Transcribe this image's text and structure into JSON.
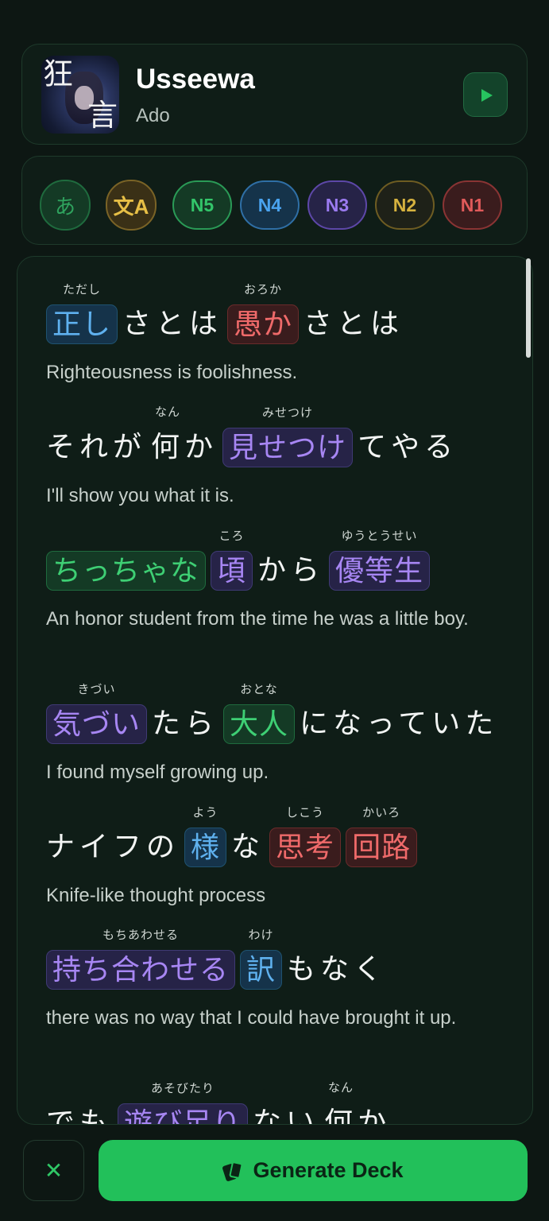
{
  "song": {
    "title": "Usseewa",
    "artist": "Ado",
    "cover_text_top": "狂",
    "cover_text_bottom": "言",
    "play_icon": "play-icon"
  },
  "filters": {
    "hiragana": "あ",
    "grammar": "文A",
    "levels": [
      "N5",
      "N4",
      "N3",
      "N2",
      "N1"
    ],
    "colors": {
      "hiragana": "#2fa35e",
      "grammar": "#e0b53d",
      "N5": "#33c56a",
      "N4": "#4aa3ef",
      "N3": "#9b7bf0",
      "N2": "#d6b23f",
      "N1": "#e05a5a"
    }
  },
  "lyrics": [
    {
      "segments": [
        {
          "text": "正し",
          "ruby": "ただし",
          "level": "blue"
        },
        {
          "text": "さとは"
        },
        {
          "text": "愚か",
          "ruby": "おろか",
          "level": "red"
        },
        {
          "text": "さとは"
        }
      ],
      "translation": "Righteousness is foolishness."
    },
    {
      "segments": [
        {
          "text": "それが"
        },
        {
          "text": "何",
          "ruby": "なん"
        },
        {
          "text": "か"
        },
        {
          "text": "見せつけ",
          "ruby": "みせつけ",
          "level": "purple"
        },
        {
          "text": "てやる"
        }
      ],
      "translation": "I'll show you what it is."
    },
    {
      "segments": [
        {
          "text": "ちっちゃな",
          "level": "green"
        },
        {
          "text": "頃",
          "ruby": "ころ",
          "level": "purple"
        },
        {
          "text": "から"
        },
        {
          "text": "優等生",
          "ruby": "ゆうとうせい",
          "level": "purple"
        }
      ],
      "translation": "An honor student from the time he was a little boy."
    },
    {
      "segments": [
        {
          "text": "気づい",
          "ruby": "きづい",
          "level": "purple"
        },
        {
          "text": "たら"
        },
        {
          "text": "大人",
          "ruby": "おとな",
          "level": "green"
        },
        {
          "text": "になっていた"
        }
      ],
      "translation": "I found myself growing up."
    },
    {
      "segments": [
        {
          "text": "ナイフの"
        },
        {
          "text": "様",
          "ruby": "よう",
          "level": "blue"
        },
        {
          "text": "な"
        },
        {
          "text": "思考",
          "ruby": "しこう",
          "level": "red"
        },
        {
          "text": "回路",
          "ruby": "かいろ",
          "level": "red"
        }
      ],
      "translation": "Knife-like thought process"
    },
    {
      "segments": [
        {
          "text": "持ち合わせる",
          "ruby": "もちあわせる",
          "level": "purple"
        },
        {
          "text": "訳",
          "ruby": "わけ",
          "level": "blue"
        },
        {
          "text": "もなく"
        }
      ],
      "translation": "there was no way that I could have brought it up."
    },
    {
      "segments": [
        {
          "text": "でも"
        },
        {
          "text": "遊び足り",
          "ruby": "あそびたり",
          "level": "purple"
        },
        {
          "text": "ない"
        },
        {
          "text": "何",
          "ruby": "なん"
        },
        {
          "text": "か"
        }
      ],
      "translation": ""
    }
  ],
  "footer": {
    "close_icon": "close-icon",
    "generate_label": "Generate Deck",
    "generate_icon": "cards-icon"
  }
}
